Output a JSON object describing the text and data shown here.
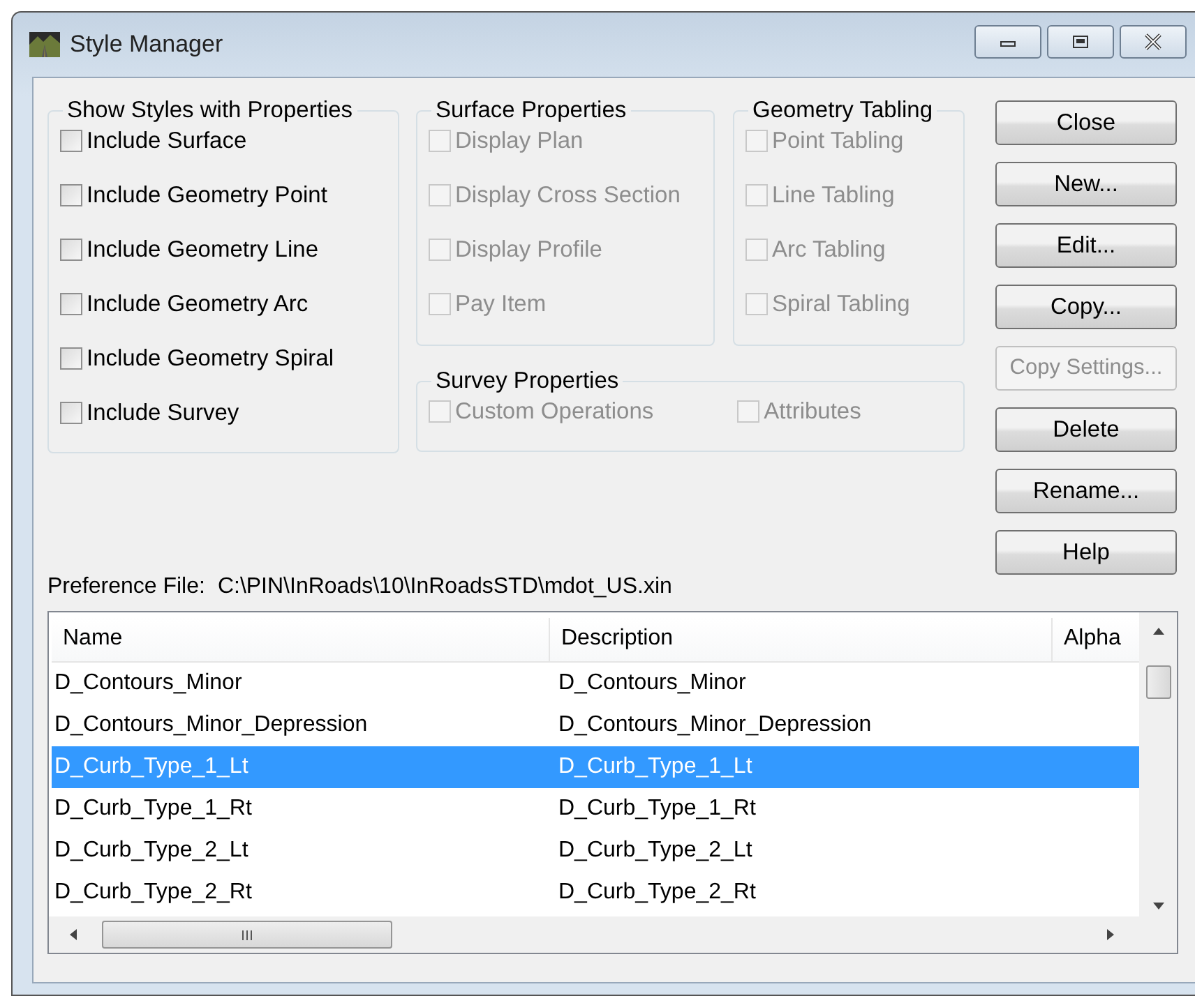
{
  "window": {
    "title": "Style Manager"
  },
  "groups": [
    {
      "title": "Show Styles with Properties",
      "items": [
        {
          "label": "Include Surface",
          "checked": false,
          "disabled": false
        },
        {
          "label": "Include Geometry Point",
          "checked": false,
          "disabled": false
        },
        {
          "label": "Include Geometry Line",
          "checked": false,
          "disabled": false
        },
        {
          "label": "Include Geometry Arc",
          "checked": false,
          "disabled": false
        },
        {
          "label": "Include Geometry Spiral",
          "checked": false,
          "disabled": false
        },
        {
          "label": "Include Survey",
          "checked": false,
          "disabled": false
        }
      ]
    },
    {
      "title": "Surface Properties",
      "items": [
        {
          "label": "Display Plan",
          "checked": false,
          "disabled": true
        },
        {
          "label": "Display Cross Section",
          "checked": false,
          "disabled": true
        },
        {
          "label": "Display Profile",
          "checked": false,
          "disabled": true
        },
        {
          "label": "Pay Item",
          "checked": false,
          "disabled": true
        }
      ]
    },
    {
      "title": "Geometry Tabling",
      "items": [
        {
          "label": "Point Tabling",
          "checked": false,
          "disabled": true
        },
        {
          "label": "Line Tabling",
          "checked": false,
          "disabled": true
        },
        {
          "label": "Arc Tabling",
          "checked": false,
          "disabled": true
        },
        {
          "label": "Spiral Tabling",
          "checked": false,
          "disabled": true
        }
      ]
    },
    {
      "title": "Survey Properties",
      "items": [
        {
          "label": "Custom Operations",
          "checked": false,
          "disabled": true
        },
        {
          "label": "Attributes",
          "checked": false,
          "disabled": true
        }
      ]
    }
  ],
  "buttons": [
    {
      "label": "Close",
      "disabled": false
    },
    {
      "label": "New...",
      "disabled": false
    },
    {
      "label": "Edit...",
      "disabled": false
    },
    {
      "label": "Copy...",
      "disabled": false
    },
    {
      "label": "Copy Settings...",
      "disabled": true
    },
    {
      "label": "Delete",
      "disabled": false
    },
    {
      "label": "Rename...",
      "disabled": false
    },
    {
      "label": "Help",
      "disabled": false
    }
  ],
  "preference_file": {
    "label": "Preference File:",
    "path": "C:\\PIN\\InRoads\\10\\InRoadsSTD\\mdot_US.xin"
  },
  "table": {
    "columns": [
      "Name",
      "Description",
      "Alpha"
    ],
    "rows": [
      {
        "cells": [
          "D_Contours_Minor",
          "D_Contours_Minor"
        ],
        "selected": false
      },
      {
        "cells": [
          "D_Contours_Minor_Depression",
          "D_Contours_Minor_Depression"
        ],
        "selected": false
      },
      {
        "cells": [
          "D_Curb_Type_1_Lt",
          "D_Curb_Type_1_Lt"
        ],
        "selected": true
      },
      {
        "cells": [
          "D_Curb_Type_1_Rt",
          "D_Curb_Type_1_Rt"
        ],
        "selected": false
      },
      {
        "cells": [
          "D_Curb_Type_2_Lt",
          "D_Curb_Type_2_Lt"
        ],
        "selected": false
      },
      {
        "cells": [
          "D_Curb_Type_2_Rt",
          "D_Curb_Type_2_Rt"
        ],
        "selected": false
      }
    ]
  }
}
